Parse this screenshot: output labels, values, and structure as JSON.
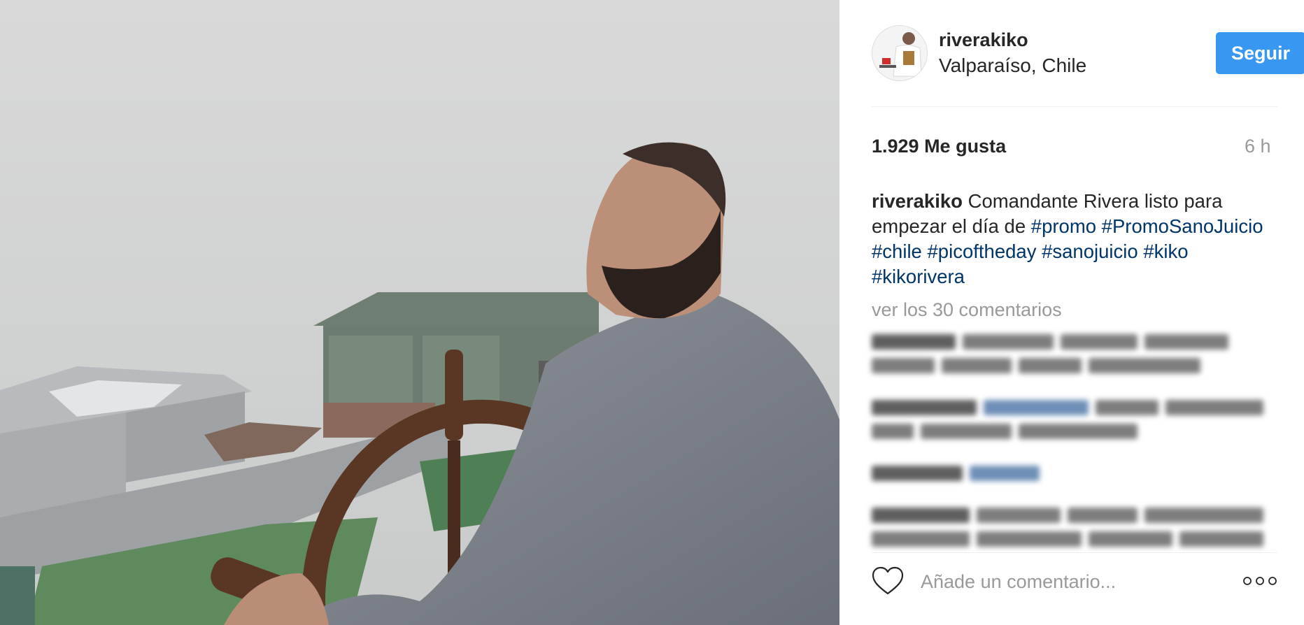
{
  "post": {
    "username": "riverakiko",
    "location": "Valparaíso, Chile",
    "follow_label": "Seguir",
    "likes": "1.929 Me gusta",
    "time_ago": "6 h",
    "caption": {
      "username": "riverakiko",
      "text": "Comandante Rivera listo para empezar el día de",
      "hashtags": [
        "#promo",
        "#PromoSanoJuicio",
        "#chile",
        "#picoftheday",
        "#sanojuicio",
        "#kiko",
        "#kikorivera"
      ]
    },
    "view_comments": "ver los 30 comentarios",
    "comment_placeholder": "Añade un comentario..."
  },
  "icons": {
    "like": "heart-icon",
    "options": "more-options-icon"
  },
  "colors": {
    "follow_button": "#3897f0",
    "hashtag": "#003569",
    "muted_text": "#999999"
  }
}
